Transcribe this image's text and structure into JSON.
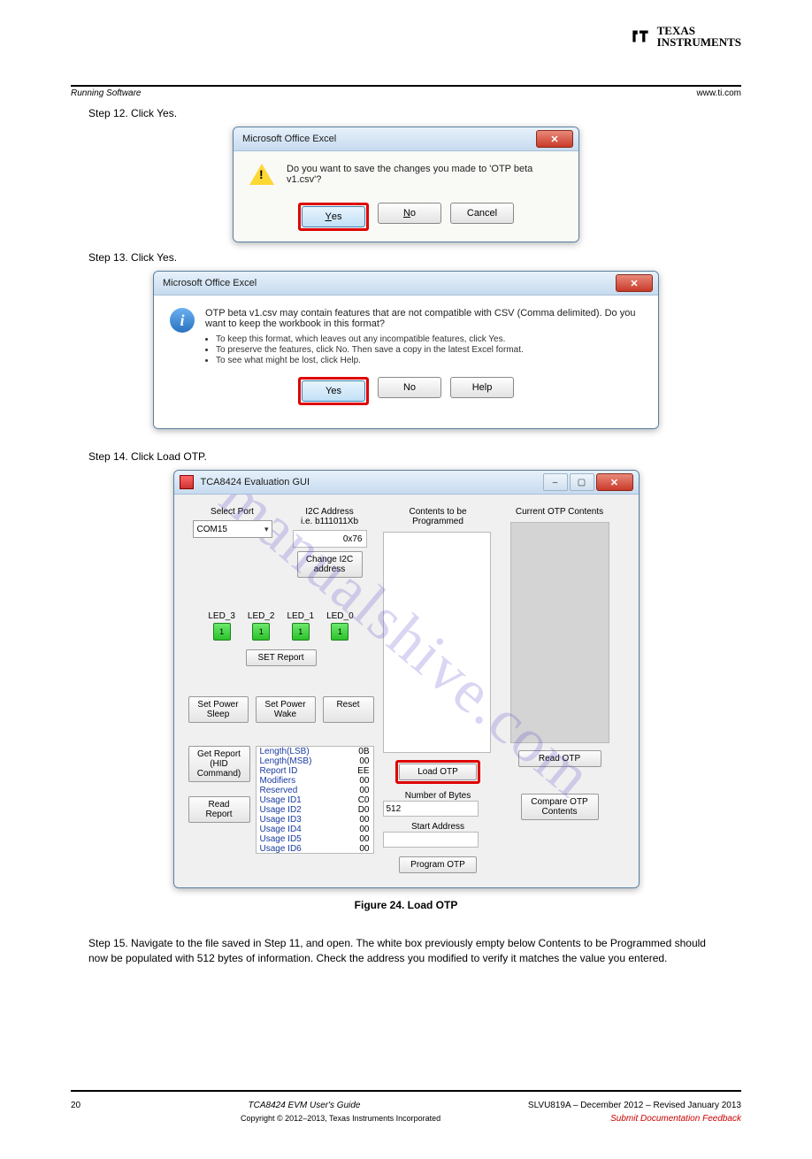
{
  "header": {
    "brand_line1": "TEXAS",
    "brand_line2": "INSTRUMENTS",
    "left_italic": "Running Software",
    "right_link": "www.ti.com"
  },
  "watermark": "manualshive.com",
  "steps": {
    "s12": "Step 12. Click Yes.",
    "s13": "Step 13. Click Yes.",
    "s14": "Step 14. Click Load OTP."
  },
  "dlg1": {
    "title": "Microsoft Office Excel",
    "msg": "Do you want to save the changes you made to 'OTP beta v1.csv'?",
    "yes": "Yes",
    "no": "No",
    "cancel": "Cancel"
  },
  "dlg2": {
    "title": "Microsoft Office Excel",
    "msg_top": "OTP beta v1.csv may contain features that are not compatible with CSV (Comma delimited). Do you want to keep the workbook in this format?",
    "b1": "To keep this format, which leaves out any incompatible features, click Yes.",
    "b2": "To preserve the features, click No. Then save a copy in the latest Excel format.",
    "b3": "To see what might be lost, click Help.",
    "yes": "Yes",
    "no": "No",
    "help": "Help"
  },
  "app": {
    "title": "TCA8424 Evaluation GUI",
    "select_port": "Select Port",
    "com": "COM15",
    "i2c_lbl1": "I2C Address",
    "i2c_lbl2": "i.e. b111011Xb",
    "i2c_val": "0x76",
    "change_i2c": "Change I2C address",
    "leds": [
      "LED_3",
      "LED_2",
      "LED_1",
      "LED_0"
    ],
    "led_val": "1",
    "set_report": "SET Report",
    "sleep": "Set Power Sleep",
    "wake": "Set Power Wake",
    "reset": "Reset",
    "get_report": "Get Report (HID Command)",
    "read_report": "Read Report",
    "report": [
      [
        "Length(LSB)",
        "0B"
      ],
      [
        "Length(MSB)",
        "00"
      ],
      [
        "Report ID",
        "EE"
      ],
      [
        "Modifiers",
        "00"
      ],
      [
        "Reserved",
        "00"
      ],
      [
        "Usage ID1",
        "C0"
      ],
      [
        "Usage ID2",
        "D0"
      ],
      [
        "Usage ID3",
        "00"
      ],
      [
        "Usage ID4",
        "00"
      ],
      [
        "Usage ID5",
        "00"
      ],
      [
        "Usage ID6",
        "00"
      ]
    ],
    "contents_lbl": "Contents to be Programmed",
    "current_lbl": "Current OTP Contents",
    "load_otp": "Load OTP",
    "read_otp": "Read OTP",
    "num_bytes_lbl": "Number of Bytes",
    "num_bytes": "512",
    "start_addr_lbl": "Start Address",
    "start_addr": "",
    "program_otp": "Program OTP",
    "compare": "Compare OTP Contents"
  },
  "figure": "Figure 24. Load OTP",
  "caption_s15": "Step 15. Navigate to the file saved in Step 11, and open. The white box previously empty below Contents to be Programmed should now be populated with 512 bytes of information. Check the address you modified to verify it matches the value you entered.",
  "footer": {
    "left": "20",
    "mid_i": "TCA8424 EVM User's Guide",
    "right": "SLVU819A – December 2012 – Revised January 2013",
    "sub_i": "Submit Documentation Feedback",
    "copy": "Copyright © 2012–2013, Texas Instruments Incorporated"
  }
}
